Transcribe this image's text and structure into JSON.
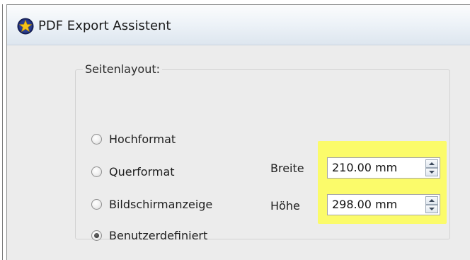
{
  "window": {
    "title": "PDF Export Assistent",
    "icon": "star-app-icon"
  },
  "page_layout": {
    "group_label": "Seitenlayout:",
    "options": [
      {
        "label": "Hochformat",
        "checked": false
      },
      {
        "label": "Querformat",
        "checked": false
      },
      {
        "label": "Bildschirmanzeige",
        "checked": false
      },
      {
        "label": "Benutzerdefiniert",
        "checked": true
      }
    ],
    "width_label": "Breite",
    "width_value": "210.00 mm",
    "height_label": "Höhe",
    "height_value": "298.00 mm"
  },
  "colors": {
    "highlight": "#fbfb6a",
    "title_gradient_top": "#fbfcfd",
    "title_gradient_bottom": "#dde6ef",
    "window_background": "#ececec"
  }
}
